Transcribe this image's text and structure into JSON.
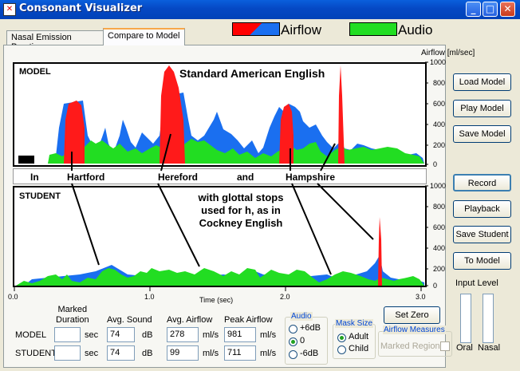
{
  "window": {
    "title": "Consonant Visualizer"
  },
  "tabs": [
    {
      "label": "Nasal Emission Practice",
      "active": false
    },
    {
      "label": "Compare to Model",
      "active": true
    }
  ],
  "legend": [
    {
      "label": "Airflow",
      "color": "#ff0000",
      "color2": "#1a6ff0"
    },
    {
      "label": "Audio",
      "color": "#22dd22"
    }
  ],
  "plots": {
    "axis_title": "Airflow [ml/sec]",
    "right_ticks": [
      "1000",
      "800",
      "600",
      "400",
      "200",
      "0"
    ],
    "model_label": "MODEL",
    "student_label": "STUDENT",
    "model_annotation": "Standard American English",
    "student_annotation": [
      "with glottal stops",
      "used for h, as in",
      "Cockney English"
    ],
    "words": [
      "In",
      "Hartford",
      "Hereford",
      "and",
      "Hampshire"
    ],
    "x_ticks": [
      "0.0",
      "1.0",
      "2.0",
      "3.0"
    ],
    "x_label": "Time (sec)"
  },
  "buttons": {
    "load_model": "Load Model",
    "play_model": "Play Model",
    "save_model": "Save Model",
    "record": "Record",
    "playback": "Playback",
    "save_student": "Save Student",
    "to_model": "To Model",
    "set_zero": "Set Zero"
  },
  "stats": {
    "headers": {
      "marked_duration": [
        "Marked",
        "Duration"
      ],
      "avg_sound": "Avg. Sound",
      "avg_airflow": "Avg. Airflow",
      "peak_airflow": "Peak Airflow"
    },
    "rows": [
      {
        "label": "MODEL",
        "duration": "",
        "avg_sound": "74",
        "avg_airflow": "278",
        "peak_airflow": "981"
      },
      {
        "label": "STUDENT",
        "duration": "",
        "avg_sound": "74",
        "avg_airflow": "99",
        "peak_airflow": "711"
      }
    ],
    "units": {
      "sec": "sec",
      "db": "dB",
      "mls": "ml/s"
    }
  },
  "audio_group": {
    "title": "Audio",
    "options": [
      "+6dB",
      "0",
      "-6dB"
    ],
    "selected": "0"
  },
  "mask_group": {
    "title": "Mask Size",
    "options": [
      "Adult",
      "Child"
    ],
    "selected": "Adult"
  },
  "airflow_measures": {
    "title": "Airflow Measures",
    "marked_region_label": "Marked Region",
    "checked": false
  },
  "input_level": {
    "title": "Input Level",
    "oral": "Oral",
    "nasal": "Nasal",
    "oral_level": 0,
    "nasal_level": 0
  }
}
